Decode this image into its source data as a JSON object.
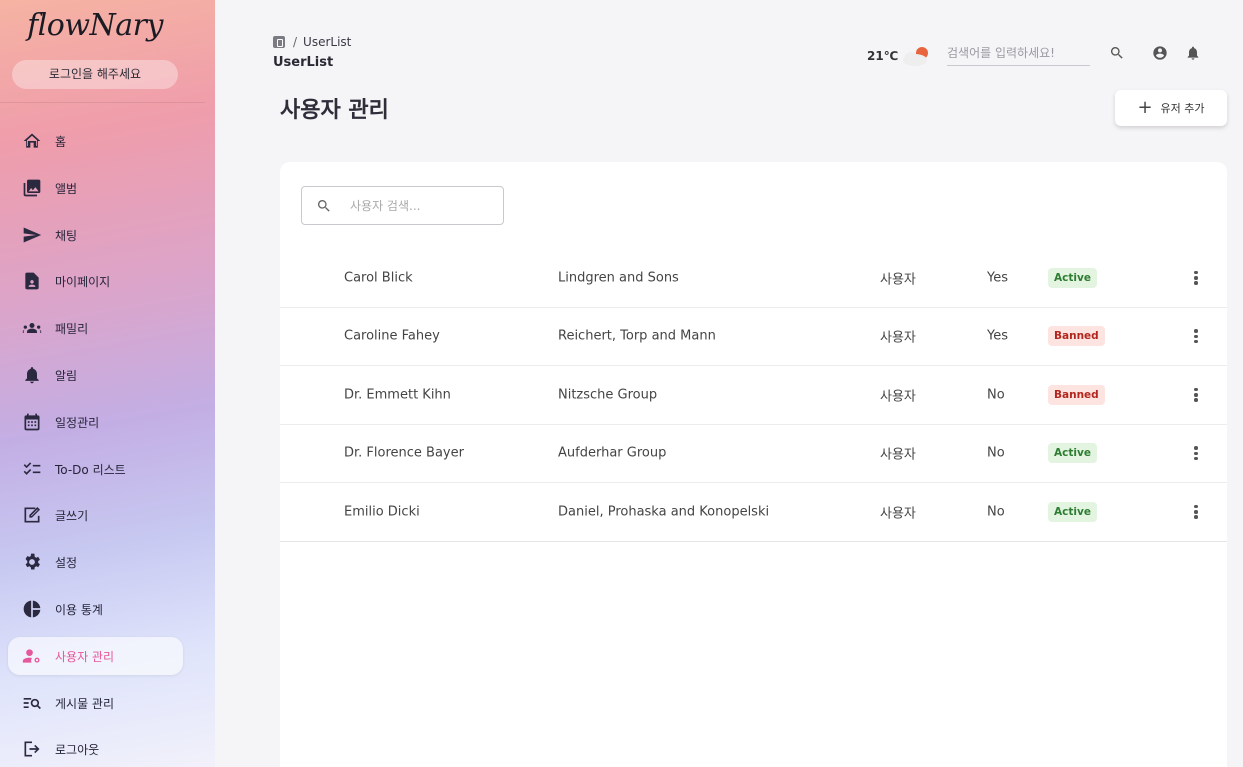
{
  "app": {
    "logo": "flowNary",
    "login_button": "로그인을 해주세요"
  },
  "sidebar": {
    "items": [
      {
        "label": "홈",
        "icon": "home-icon"
      },
      {
        "label": "앨범",
        "icon": "album-icon"
      },
      {
        "label": "채팅",
        "icon": "send-icon"
      },
      {
        "label": "마이페이지",
        "icon": "profile-doc-icon"
      },
      {
        "label": "패밀리",
        "icon": "family-icon"
      },
      {
        "label": "알림",
        "icon": "bell-icon"
      },
      {
        "label": "일정관리",
        "icon": "calendar-icon"
      },
      {
        "label": "To-Do 리스트",
        "icon": "checklist-icon"
      },
      {
        "label": "글쓰기",
        "icon": "edit-icon"
      },
      {
        "label": "설정",
        "icon": "gear-icon"
      },
      {
        "label": "이용 통계",
        "icon": "pie-chart-icon"
      },
      {
        "label": "사용자 관리",
        "icon": "user-manage-icon",
        "active": true
      },
      {
        "label": "게시물 관리",
        "icon": "post-manage-icon"
      },
      {
        "label": "로그아웃",
        "icon": "logout-icon"
      }
    ],
    "active_color": "#e6579b"
  },
  "header": {
    "breadcrumb_current": "UserList",
    "page_subtitle": "UserList",
    "temperature": "21℃",
    "weather_icon": "partly-cloudy-sun-icon",
    "search_placeholder": "검색어를 입력하세요!"
  },
  "main": {
    "title": "사용자 관리",
    "add_button": "유저 추가",
    "search_placeholder": "사용자 검색...",
    "users": [
      {
        "name": "Carol Blick",
        "company": "Lindgren and Sons",
        "role": "사용자",
        "verified": "Yes",
        "status": "Active"
      },
      {
        "name": "Caroline Fahey",
        "company": "Reichert, Torp and Mann",
        "role": "사용자",
        "verified": "Yes",
        "status": "Banned"
      },
      {
        "name": "Dr. Emmett Kihn",
        "company": "Nitzsche Group",
        "role": "사용자",
        "verified": "No",
        "status": "Banned"
      },
      {
        "name": "Dr. Florence Bayer",
        "company": "Aufderhar Group",
        "role": "사용자",
        "verified": "No",
        "status": "Active"
      },
      {
        "name": "Emilio Dicki",
        "company": "Daniel, Prohaska and Konopelski",
        "role": "사용자",
        "verified": "No",
        "status": "Active"
      }
    ]
  }
}
